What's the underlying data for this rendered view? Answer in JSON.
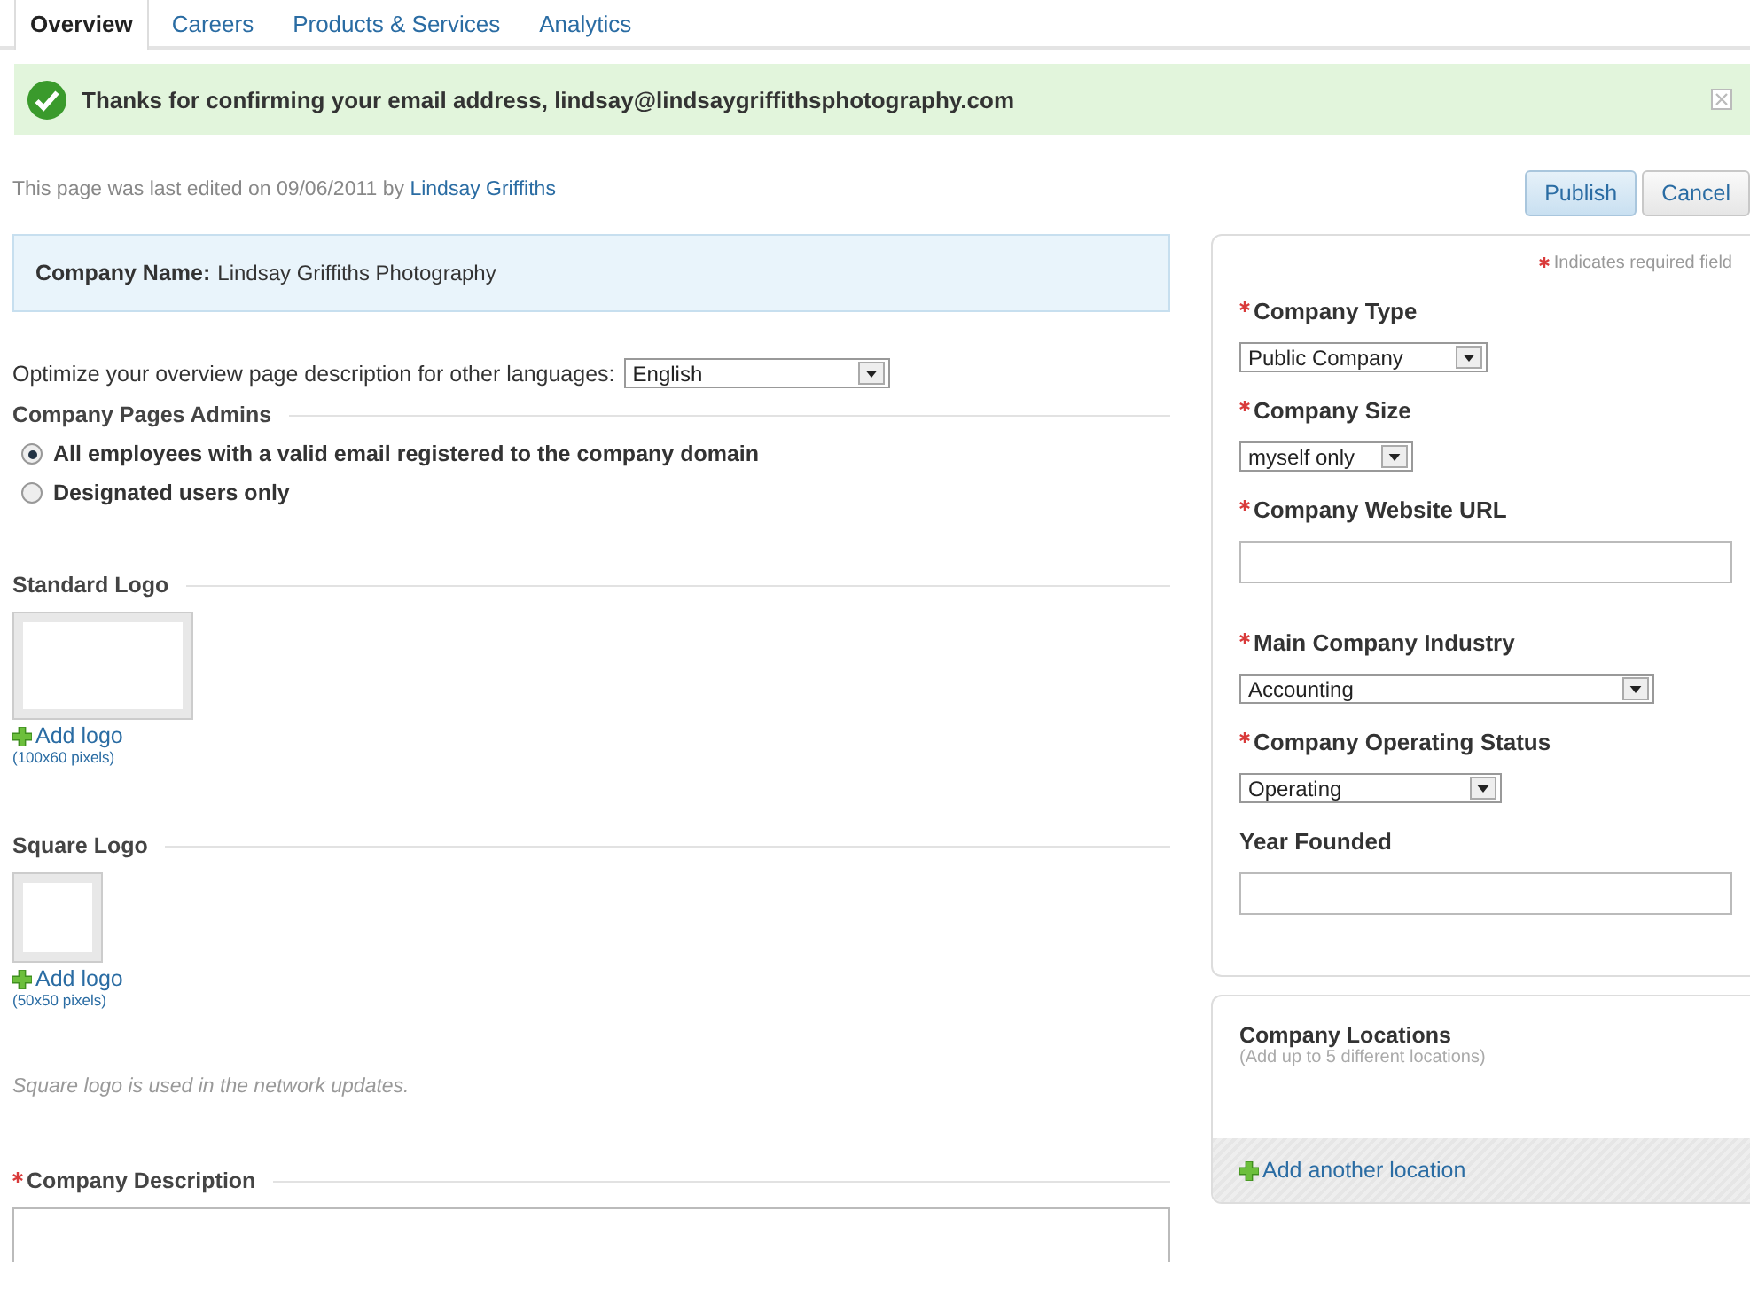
{
  "tabs": [
    {
      "label": "Overview",
      "selected": true
    },
    {
      "label": "Careers",
      "selected": false
    },
    {
      "label": "Products & Services",
      "selected": false
    },
    {
      "label": "Analytics",
      "selected": false
    }
  ],
  "banner": {
    "message": "Thanks for confirming your email address, lindsay@lindsaygriffithsphotography.com"
  },
  "edit_note": {
    "text": "This page was last edited on 09/06/2011 by",
    "author": "Lindsay Griffiths"
  },
  "actions": [
    {
      "label": "Publish",
      "kind": "primary"
    },
    {
      "label": "Cancel",
      "kind": "secondary"
    }
  ],
  "company_name": {
    "label": "Company Name:",
    "value": "Lindsay Griffiths Photography"
  },
  "language": {
    "label": "Optimize your overview page description for other languages:",
    "value": "English"
  },
  "admins": {
    "title": "Company Pages Admins",
    "options": [
      {
        "label": "All employees with a valid email registered to the company domain",
        "selected": true
      },
      {
        "label": "Designated users only",
        "selected": false
      }
    ]
  },
  "logos": [
    {
      "kind": "standard",
      "title": "Standard Logo",
      "add_label": "Add logo",
      "size_hint": "(100x60 pixels)"
    },
    {
      "kind": "square",
      "title": "Square Logo",
      "add_label": "Add logo",
      "size_hint": "(50x50 pixels)"
    }
  ],
  "logo_note": "Square logo is used in the network updates.",
  "description": {
    "title": "Company Description",
    "required": true
  },
  "sidebar": {
    "legend": "Indicates required field",
    "fields": [
      {
        "kind": "select",
        "label": "Company Type",
        "required": true,
        "value": "Public Company"
      },
      {
        "kind": "select",
        "label": "Company Size",
        "required": true,
        "value": "myself only"
      },
      {
        "kind": "text",
        "label": "Company Website URL",
        "required": true
      },
      {
        "kind": "select",
        "label": "Main Company Industry",
        "required": true,
        "value": "Accounting"
      },
      {
        "kind": "select",
        "label": "Company Operating Status",
        "required": true,
        "value": "Operating"
      },
      {
        "kind": "text",
        "label": "Year Founded",
        "required": false
      }
    ]
  },
  "locations": {
    "title": "Company Locations",
    "hint": "(Add up to 5 different locations)",
    "add_label": "Add another location"
  }
}
